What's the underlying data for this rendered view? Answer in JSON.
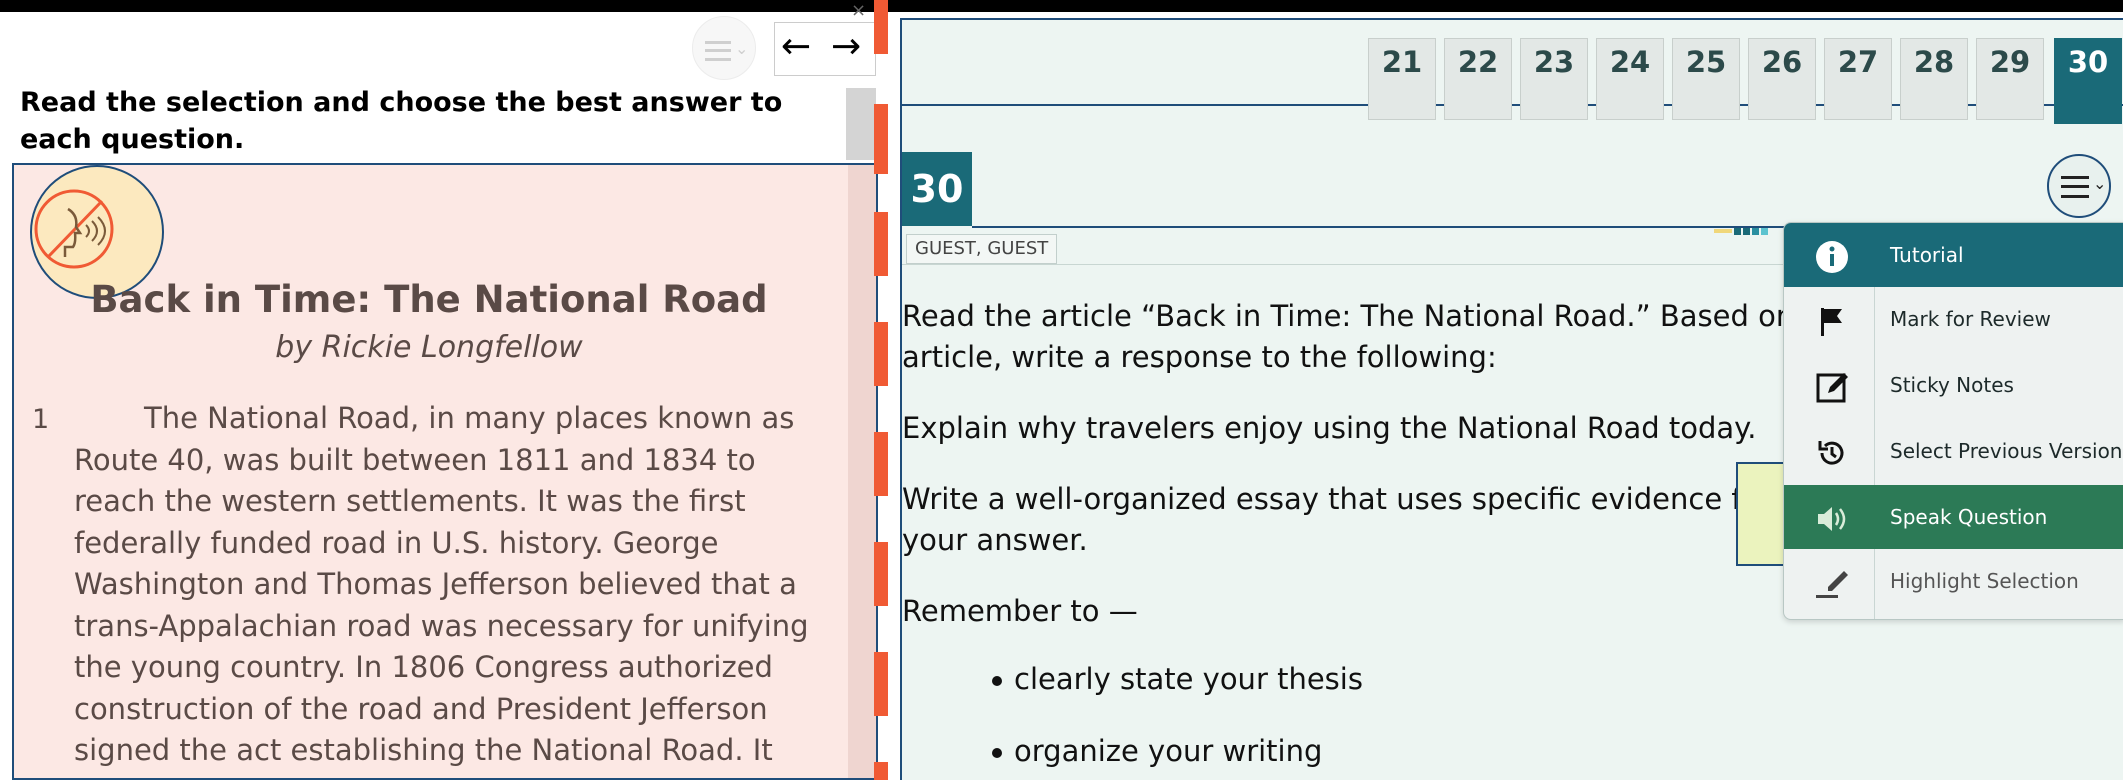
{
  "left": {
    "instructions": "Read the selection and choose the best answer to each question.",
    "passage": {
      "title": "Back in Time: The National Road",
      "author": "by Rickie Longfellow",
      "paragraph_number": "1",
      "paragraph_text": "The National Road, in many places known as Route 40, was built between 1811 and 1834 to reach the western settlements. It was the first federally funded road in U.S. history. George Washington and Thomas Jefferson believed that a trans-Appalachian road was necessary for unifying the young country. In 1806 Congress authorized construction of the road and President Jefferson signed the act establishing the National Road. It"
    },
    "nav": {
      "prev": "←",
      "next": "→"
    },
    "close": "×"
  },
  "tabs": [
    {
      "label": "21"
    },
    {
      "label": "22"
    },
    {
      "label": "23"
    },
    {
      "label": "24"
    },
    {
      "label": "25"
    },
    {
      "label": "26"
    },
    {
      "label": "27"
    },
    {
      "label": "28"
    },
    {
      "label": "29"
    },
    {
      "label": "30",
      "active": true
    }
  ],
  "question": {
    "number": "30",
    "student": "GUEST, GUEST",
    "prompt_line1": "Read the article “Back in Time: The National Road.” Based on",
    "prompt_line2": "article, write a response to the following:",
    "explain": "Explain why travelers enjoy using the National Road today.",
    "write_line1": "Write a well-organized essay that uses specific evidence from",
    "write_line2": "your answer.",
    "remember": "Remember to —",
    "bullets": [
      "clearly state your thesis",
      "organize your writing"
    ]
  },
  "menu": {
    "items": [
      {
        "label": "Tutorial",
        "icon": "info-icon",
        "state": "selected"
      },
      {
        "label": "Mark for Review",
        "icon": "flag-icon",
        "state": "normal"
      },
      {
        "label": "Sticky Notes",
        "icon": "note-edit-icon",
        "state": "normal"
      },
      {
        "label": "Select Previous Version",
        "icon": "history-icon",
        "state": "normal"
      },
      {
        "label": "Speak Question",
        "icon": "speaker-icon",
        "state": "highlighted"
      },
      {
        "label": "Highlight Selection",
        "icon": "highlighter-icon",
        "state": "dim"
      }
    ]
  },
  "colors": {
    "accent": "#1a6a78",
    "passage_bg": "#fce8e4",
    "question_bg": "#edf5f2",
    "speak_highlight": "#2c7a56",
    "divider_marks": "#f05a34"
  }
}
